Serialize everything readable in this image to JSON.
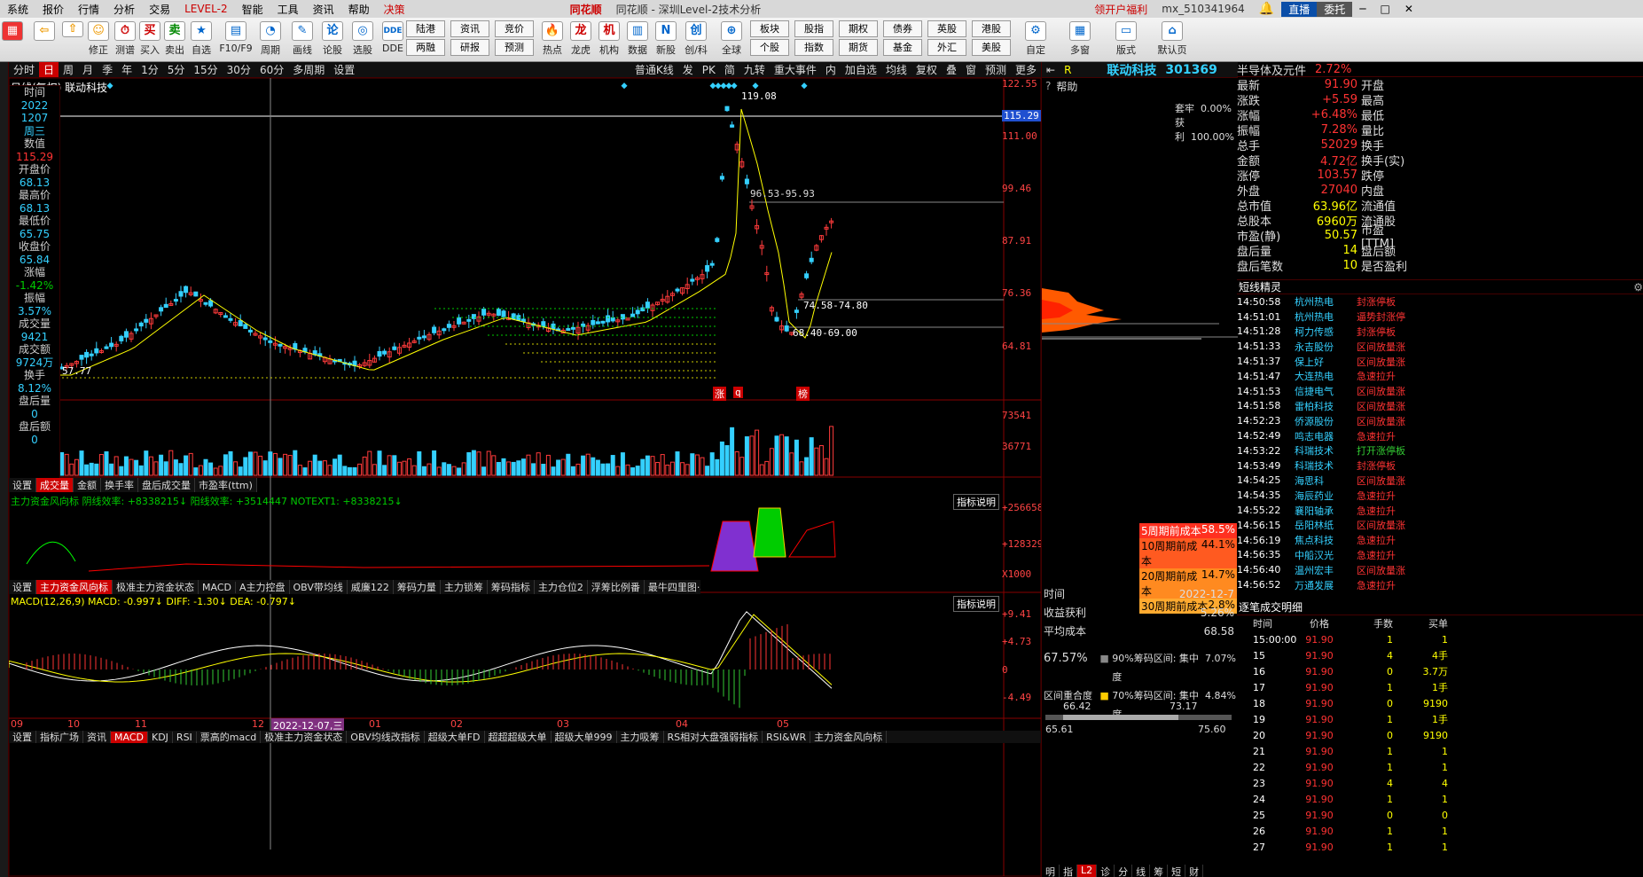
{
  "menu": [
    "系统",
    "报价",
    "行情",
    "分析",
    "交易",
    "LEVEL-2",
    "智能",
    "工具",
    "资讯",
    "帮助",
    "决策"
  ],
  "window_title": "同花顺 - 深圳Level-2技术分析",
  "top_right": {
    "promo": "领开户福利",
    "user": "mx_510341964",
    "direct": "直播",
    "entrust": "委托"
  },
  "toolbar": [
    "修正",
    "测谱",
    "买入",
    "卖出",
    "自选",
    "F10/F9",
    "周期",
    "画线",
    "论股",
    "选股",
    "DDE",
    "热点",
    "龙虎",
    "机构",
    "数据",
    "新股",
    "创/科",
    "全球",
    "个股",
    "指数",
    "期货",
    "基金",
    "外汇",
    "美股",
    "自定",
    "多窗",
    "版式",
    "默认页"
  ],
  "toolbar_small": [
    "陆港",
    "资讯",
    "竞价",
    "板块",
    "股指",
    "期权",
    "债券",
    "英股",
    "港股",
    "两融",
    "研报",
    "预测"
  ],
  "chart_toolbar": [
    "分时",
    "日",
    "周",
    "月",
    "季",
    "年",
    "1分",
    "5分",
    "15分",
    "30分",
    "60分",
    "多周期",
    "设置"
  ],
  "chart_toolbar_right": [
    "普通K线",
    "发",
    "PK",
    "简",
    "九转",
    "重大事件",
    "内",
    "加自选",
    "均线",
    "复权",
    "叠",
    "窗",
    "预测",
    "更多"
  ],
  "chart_title": "日线(复权)  联动科技",
  "info": [
    {
      "k": "时间",
      "v": "2022"
    },
    {
      "k": "",
      "v": "1207"
    },
    {
      "k": "",
      "v": "周三"
    },
    {
      "k": "数值",
      "v": "115.29"
    },
    {
      "k": "开盘价",
      "v": "68.13"
    },
    {
      "k": "最高价",
      "v": "68.13"
    },
    {
      "k": "最低价",
      "v": "65.75"
    },
    {
      "k": "收盘价",
      "v": "65.84"
    },
    {
      "k": "涨幅",
      "v": "-1.42%"
    },
    {
      "k": "振幅",
      "v": "3.57%"
    },
    {
      "k": "成交量",
      "v": "9421"
    },
    {
      "k": "成交额",
      "v": "9724万"
    },
    {
      "k": "换手",
      "v": "8.12%"
    },
    {
      "k": "盘后量",
      "v": "0"
    },
    {
      "k": "盘后额",
      "v": "0"
    }
  ],
  "price_axis": [
    "122.55",
    "115.29",
    "111.00",
    "99.46",
    "87.91",
    "76.36",
    "64.81"
  ],
  "annotations": {
    "high": "119.08",
    "low": "57.77",
    "r1": "96.53-95.93",
    "r2": "74.58-74.80",
    "r3": "68.40-69.00",
    "m1": "涨",
    "m2": "q",
    "m3": "榜"
  },
  "vol_axis": [
    "73541",
    "36771"
  ],
  "vol_tabs": [
    "设置",
    "成交量",
    "金额",
    "换手率",
    "盘后成交量",
    "市盈率(ttm)"
  ],
  "ind1_title": "主力资金风向标 阴线效率: +8338215↓  阳线效率: +3514447  NOTEXT1: +8338215↓",
  "ind1_axis": [
    "+256658",
    "+128329",
    "X1000"
  ],
  "ind1_tabs": [
    "设置",
    "主力资金风向标",
    "极准主力资金状态",
    "MACD",
    "A主力控盘",
    "OBV带均线",
    "威廉122",
    "筹码力量",
    "主力锁筹",
    "筹码指标",
    "主力仓位2",
    "浮筹比例番",
    "最牛四里图·林永"
  ],
  "ind_explain": "指标说明",
  "macd_title": "MACD(12,26,9)  MACD: -0.997↓  DIFF: -1.30↓  DEA: -0.797↓",
  "macd_axis": [
    "+9.41",
    "+4.73",
    "0",
    "-4.49"
  ],
  "x_axis": [
    "09",
    "10",
    "11",
    "12",
    "2022-12-07,三",
    "01",
    "02",
    "03",
    "04",
    "05"
  ],
  "bottom_tabs": [
    "设置",
    "指标广场",
    "资讯",
    "MACD",
    "KDJ",
    "RSI",
    "票高的macd",
    "极准主力资金状态",
    "OBV均线改指标",
    "超级大单FD",
    "超超超级大单",
    "超级大单999",
    "主力吸筹",
    "RS相对大盘强弱指标",
    "RSI&WR",
    "主力资金风向标"
  ],
  "stock": {
    "name": "联动科技",
    "code": "301369",
    "tag": "R",
    "help": "帮助"
  },
  "chip": {
    "rates": [
      {
        "k": "套牢",
        "v": "0.00%"
      },
      {
        "k": "获利",
        "v": "100.00%"
      }
    ],
    "cost": [
      {
        "k": "5周期前成本",
        "v": "58.5%"
      },
      {
        "k": "10周期前成本",
        "v": "44.1%"
      },
      {
        "k": "20周期前成本",
        "v": "14.7%"
      },
      {
        "k": "30周期前成本",
        "v": "2.8%"
      }
    ],
    "date_k": "时间",
    "date": "2022-12-7",
    "profit_k": "收益获利",
    "profit": "5.26%",
    "avg_k": "平均成本",
    "avg": "68.58",
    "conc": "67.57%",
    "c90": "90%筹码区间: 集中度",
    "c90v": "7.07%",
    "c70": "70%筹码区间: 集中度",
    "c70v": "4.84%",
    "conc_k": "区间重合度",
    "scale": [
      "66.42",
      "73.17",
      "65.61",
      "75.60"
    ]
  },
  "quote": {
    "sector": "半导体及元件",
    "sector_chg": "2.72%",
    "rows": [
      {
        "a": "最新",
        "av": "91.90",
        "b": "开盘"
      },
      {
        "a": "涨跌",
        "av": "+5.59",
        "b": "最高"
      },
      {
        "a": "涨幅",
        "av": "+6.48%",
        "b": "最低"
      },
      {
        "a": "振幅",
        "av": "7.28%",
        "b": "量比"
      },
      {
        "a": "总手",
        "av": "52029",
        "b": "换手"
      },
      {
        "a": "金额",
        "av": "4.72亿",
        "b": "换手(实)"
      },
      {
        "a": "涨停",
        "av": "103.57",
        "b": "跌停"
      },
      {
        "a": "外盘",
        "av": "27040",
        "b": "内盘"
      },
      {
        "a": "总市值",
        "av": "63.96亿",
        "b": "流通值"
      },
      {
        "a": "总股本",
        "av": "6960万",
        "b": "流通股"
      },
      {
        "a": "市盈(静)",
        "av": "50.57",
        "b": "市盈[TTM]"
      },
      {
        "a": "盘后量",
        "av": "14",
        "b": "盘后额"
      },
      {
        "a": "盘后笔数",
        "av": "10",
        "b": "是否盈利"
      }
    ]
  },
  "spirit_title": "短线精灵",
  "spirit": [
    [
      "14:50:58",
      "杭州热电",
      "封涨停板"
    ],
    [
      "14:51:01",
      "杭州热电",
      "逼势封涨停"
    ],
    [
      "14:51:28",
      "柯力传感",
      "封涨停板"
    ],
    [
      "14:51:33",
      "永吉股份",
      "区间放量涨"
    ],
    [
      "14:51:37",
      "保上好",
      "区间放量涨"
    ],
    [
      "14:51:47",
      "大连热电",
      "急速拉升"
    ],
    [
      "14:51:53",
      "信捷电气",
      "区间放量涨"
    ],
    [
      "14:51:58",
      "雷柏科技",
      "区间放量涨"
    ],
    [
      "14:52:23",
      "侨源股份",
      "区间放量涨"
    ],
    [
      "14:52:49",
      "鸣志电器",
      "急速拉升"
    ],
    [
      "14:53:22",
      "科瑞技术",
      "打开涨停板"
    ],
    [
      "14:53:49",
      "科瑞技术",
      "封涨停板"
    ],
    [
      "14:54:25",
      "海思科",
      "区间放量涨"
    ],
    [
      "14:54:35",
      "海辰药业",
      "急速拉升"
    ],
    [
      "14:55:22",
      "襄阳轴承",
      "急速拉升"
    ],
    [
      "14:56:15",
      "岳阳林纸",
      "区间放量涨"
    ],
    [
      "14:56:19",
      "焦点科技",
      "急速拉升"
    ],
    [
      "14:56:35",
      "中船汉光",
      "急速拉升"
    ],
    [
      "14:56:40",
      "温州宏丰",
      "区间放量涨"
    ],
    [
      "14:56:52",
      "万通发展",
      "急速拉升"
    ]
  ],
  "trades_title": "逐笔成交明细",
  "trades_head": [
    "时间",
    "价格",
    "手数",
    "买单"
  ],
  "trades": [
    [
      "15:00:00",
      "91.90",
      "1",
      "1"
    ],
    [
      "15",
      "91.90",
      "4",
      "4手"
    ],
    [
      "16",
      "91.90",
      "0",
      "3.7万"
    ],
    [
      "17",
      "91.90",
      "1",
      "1手"
    ],
    [
      "18",
      "91.90",
      "0",
      "9190"
    ],
    [
      "19",
      "91.90",
      "1",
      "1手"
    ],
    [
      "20",
      "91.90",
      "0",
      "9190"
    ],
    [
      "21",
      "91.90",
      "1",
      "1"
    ],
    [
      "22",
      "91.90",
      "1",
      "1"
    ],
    [
      "23",
      "91.90",
      "4",
      "4"
    ],
    [
      "24",
      "91.90",
      "1",
      "1"
    ],
    [
      "25",
      "91.90",
      "0",
      "0"
    ],
    [
      "26",
      "91.90",
      "1",
      "1"
    ],
    [
      "27",
      "91.90",
      "1",
      "1"
    ]
  ],
  "bottom_right_tabs": [
    "明",
    "指",
    "L2",
    "诊",
    "分",
    "线",
    "筹",
    "短",
    "财"
  ]
}
